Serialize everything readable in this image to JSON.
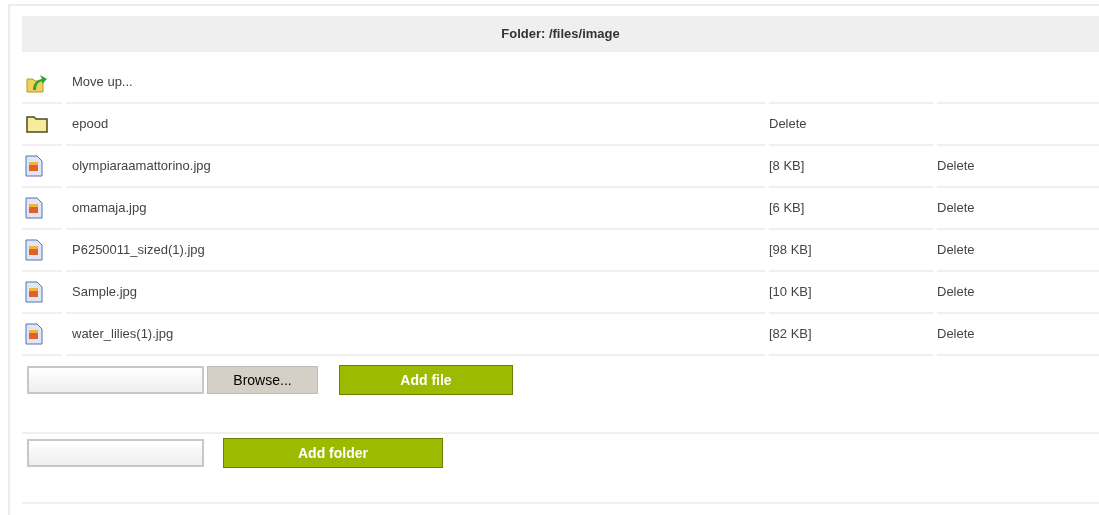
{
  "header": "Folder: /files/image",
  "entries": [
    {
      "kind": "up",
      "name": "Move up..."
    },
    {
      "kind": "folder",
      "name": "epood",
      "action": "Delete"
    },
    {
      "kind": "file",
      "name": "olympiaraamattorino.jpg",
      "size": "[8 KB]",
      "action": "Delete"
    },
    {
      "kind": "file",
      "name": "omamaja.jpg",
      "size": "[6 KB]",
      "action": "Delete"
    },
    {
      "kind": "file",
      "name": "P6250011_sized(1).jpg",
      "size": "[98 KB]",
      "action": "Delete"
    },
    {
      "kind": "file",
      "name": "Sample.jpg",
      "size": "[10 KB]",
      "action": "Delete"
    },
    {
      "kind": "file",
      "name": "water_lilies(1).jpg",
      "size": "[82 KB]",
      "action": "Delete"
    }
  ],
  "upload": {
    "browse": "Browse...",
    "button": "Add file"
  },
  "new_folder": {
    "button": "Add folder"
  }
}
